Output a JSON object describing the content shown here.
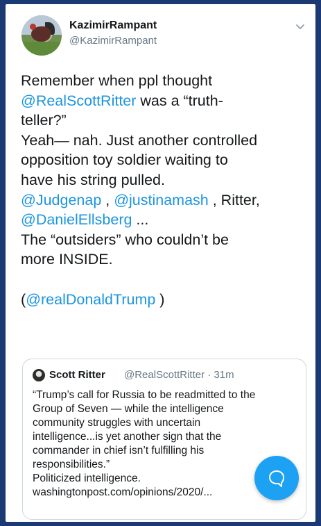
{
  "tweet": {
    "display_name": "KazimirRampant",
    "handle": "@KazimirRampant",
    "lines": [
      [
        {
          "t": "Remember when ppl thought"
        }
      ],
      [
        {
          "t": "@RealScottRitter",
          "m": true
        },
        {
          "t": " was a “truth-"
        }
      ],
      [
        {
          "t": "teller?”"
        }
      ],
      [
        {
          "t": "Yeah— nah. Just another controlled"
        }
      ],
      [
        {
          "t": "opposition toy soldier waiting to"
        }
      ],
      [
        {
          "t": "have his string pulled."
        }
      ],
      [
        {
          "t": "@Judgenap",
          "m": true
        },
        {
          "t": " , "
        },
        {
          "t": "@justinamash",
          "m": true
        },
        {
          "t": " , Ritter,"
        }
      ],
      [
        {
          "t": "@DanielEllsberg",
          "m": true
        },
        {
          "t": " ..."
        }
      ],
      [
        {
          "t": "The “outsiders” who couldn’t be"
        }
      ],
      [
        {
          "t": "more INSIDE."
        }
      ],
      [],
      [
        {
          "t": "("
        },
        {
          "t": "@realDonaldTrump",
          "m": true
        },
        {
          "t": " )"
        }
      ]
    ]
  },
  "quoted": {
    "name": "Scott Ritter",
    "meta": "@RealScottRitter · 31m",
    "lines": [
      "“Trump’s call for Russia to be readmitted to the",
      "Group of Seven — while the intelligence",
      "community struggles with uncertain",
      "intelligence...is yet another sign that the",
      "commander in chief isn’t fulfilling his",
      "responsibilities.”",
      "Politicized intelligence.",
      "washingtonpost.com/opinions/2020/..."
    ]
  },
  "icons": {
    "menu": "chevron-down-icon",
    "compose": "message-bubble-icon"
  },
  "colors": {
    "background": "#1b3a73",
    "mention": "#1b95e0",
    "fab": "#1da1f2"
  }
}
